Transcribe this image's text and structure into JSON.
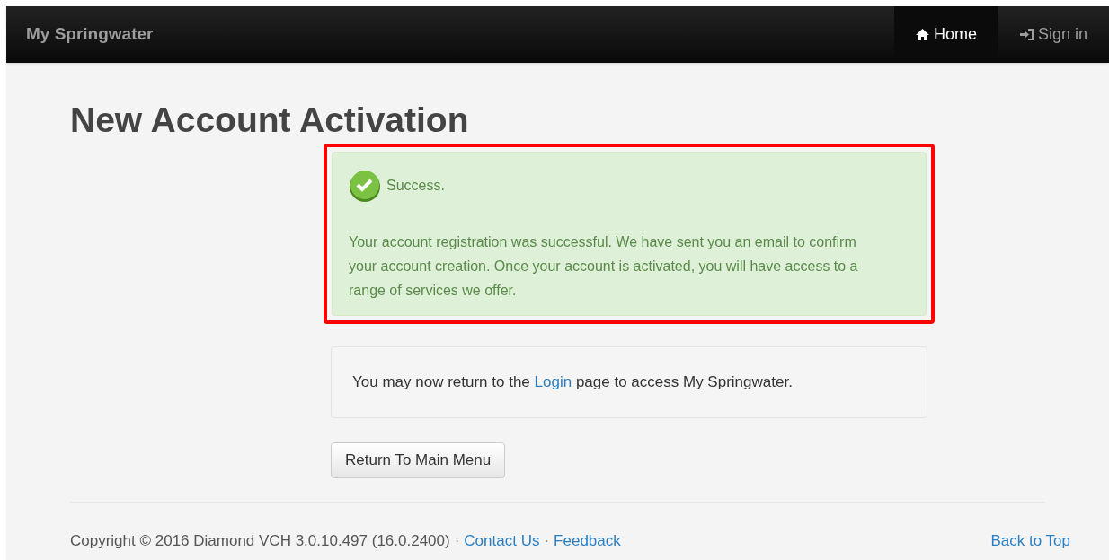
{
  "navbar": {
    "brand": "My Springwater",
    "items": [
      {
        "label": "Home",
        "kind": "home",
        "selected": true
      },
      {
        "label": "Sign in",
        "kind": "sign-in",
        "selected": false
      }
    ]
  },
  "page_title": "New Account Activation",
  "alert": {
    "highlighted": true,
    "heading": "Success.",
    "message": "Your account registration was successful. We have sent you an email to confirm your account creation. Once your account is activated, you will have access to a range of services we offer."
  },
  "info": {
    "before": "You may now return to the ",
    "link": "Login",
    "after": " page to access My Springwater."
  },
  "button": "Return To Main Menu",
  "footer": {
    "copyright": "Copyright © 2016 Diamond VCH 3.0.10.497 (16.0.2400)",
    "separator_1": "·",
    "contact": "Contact Us",
    "separator_2": "·",
    "feedback": "Feedback",
    "back_to_top": "Back to Top"
  }
}
